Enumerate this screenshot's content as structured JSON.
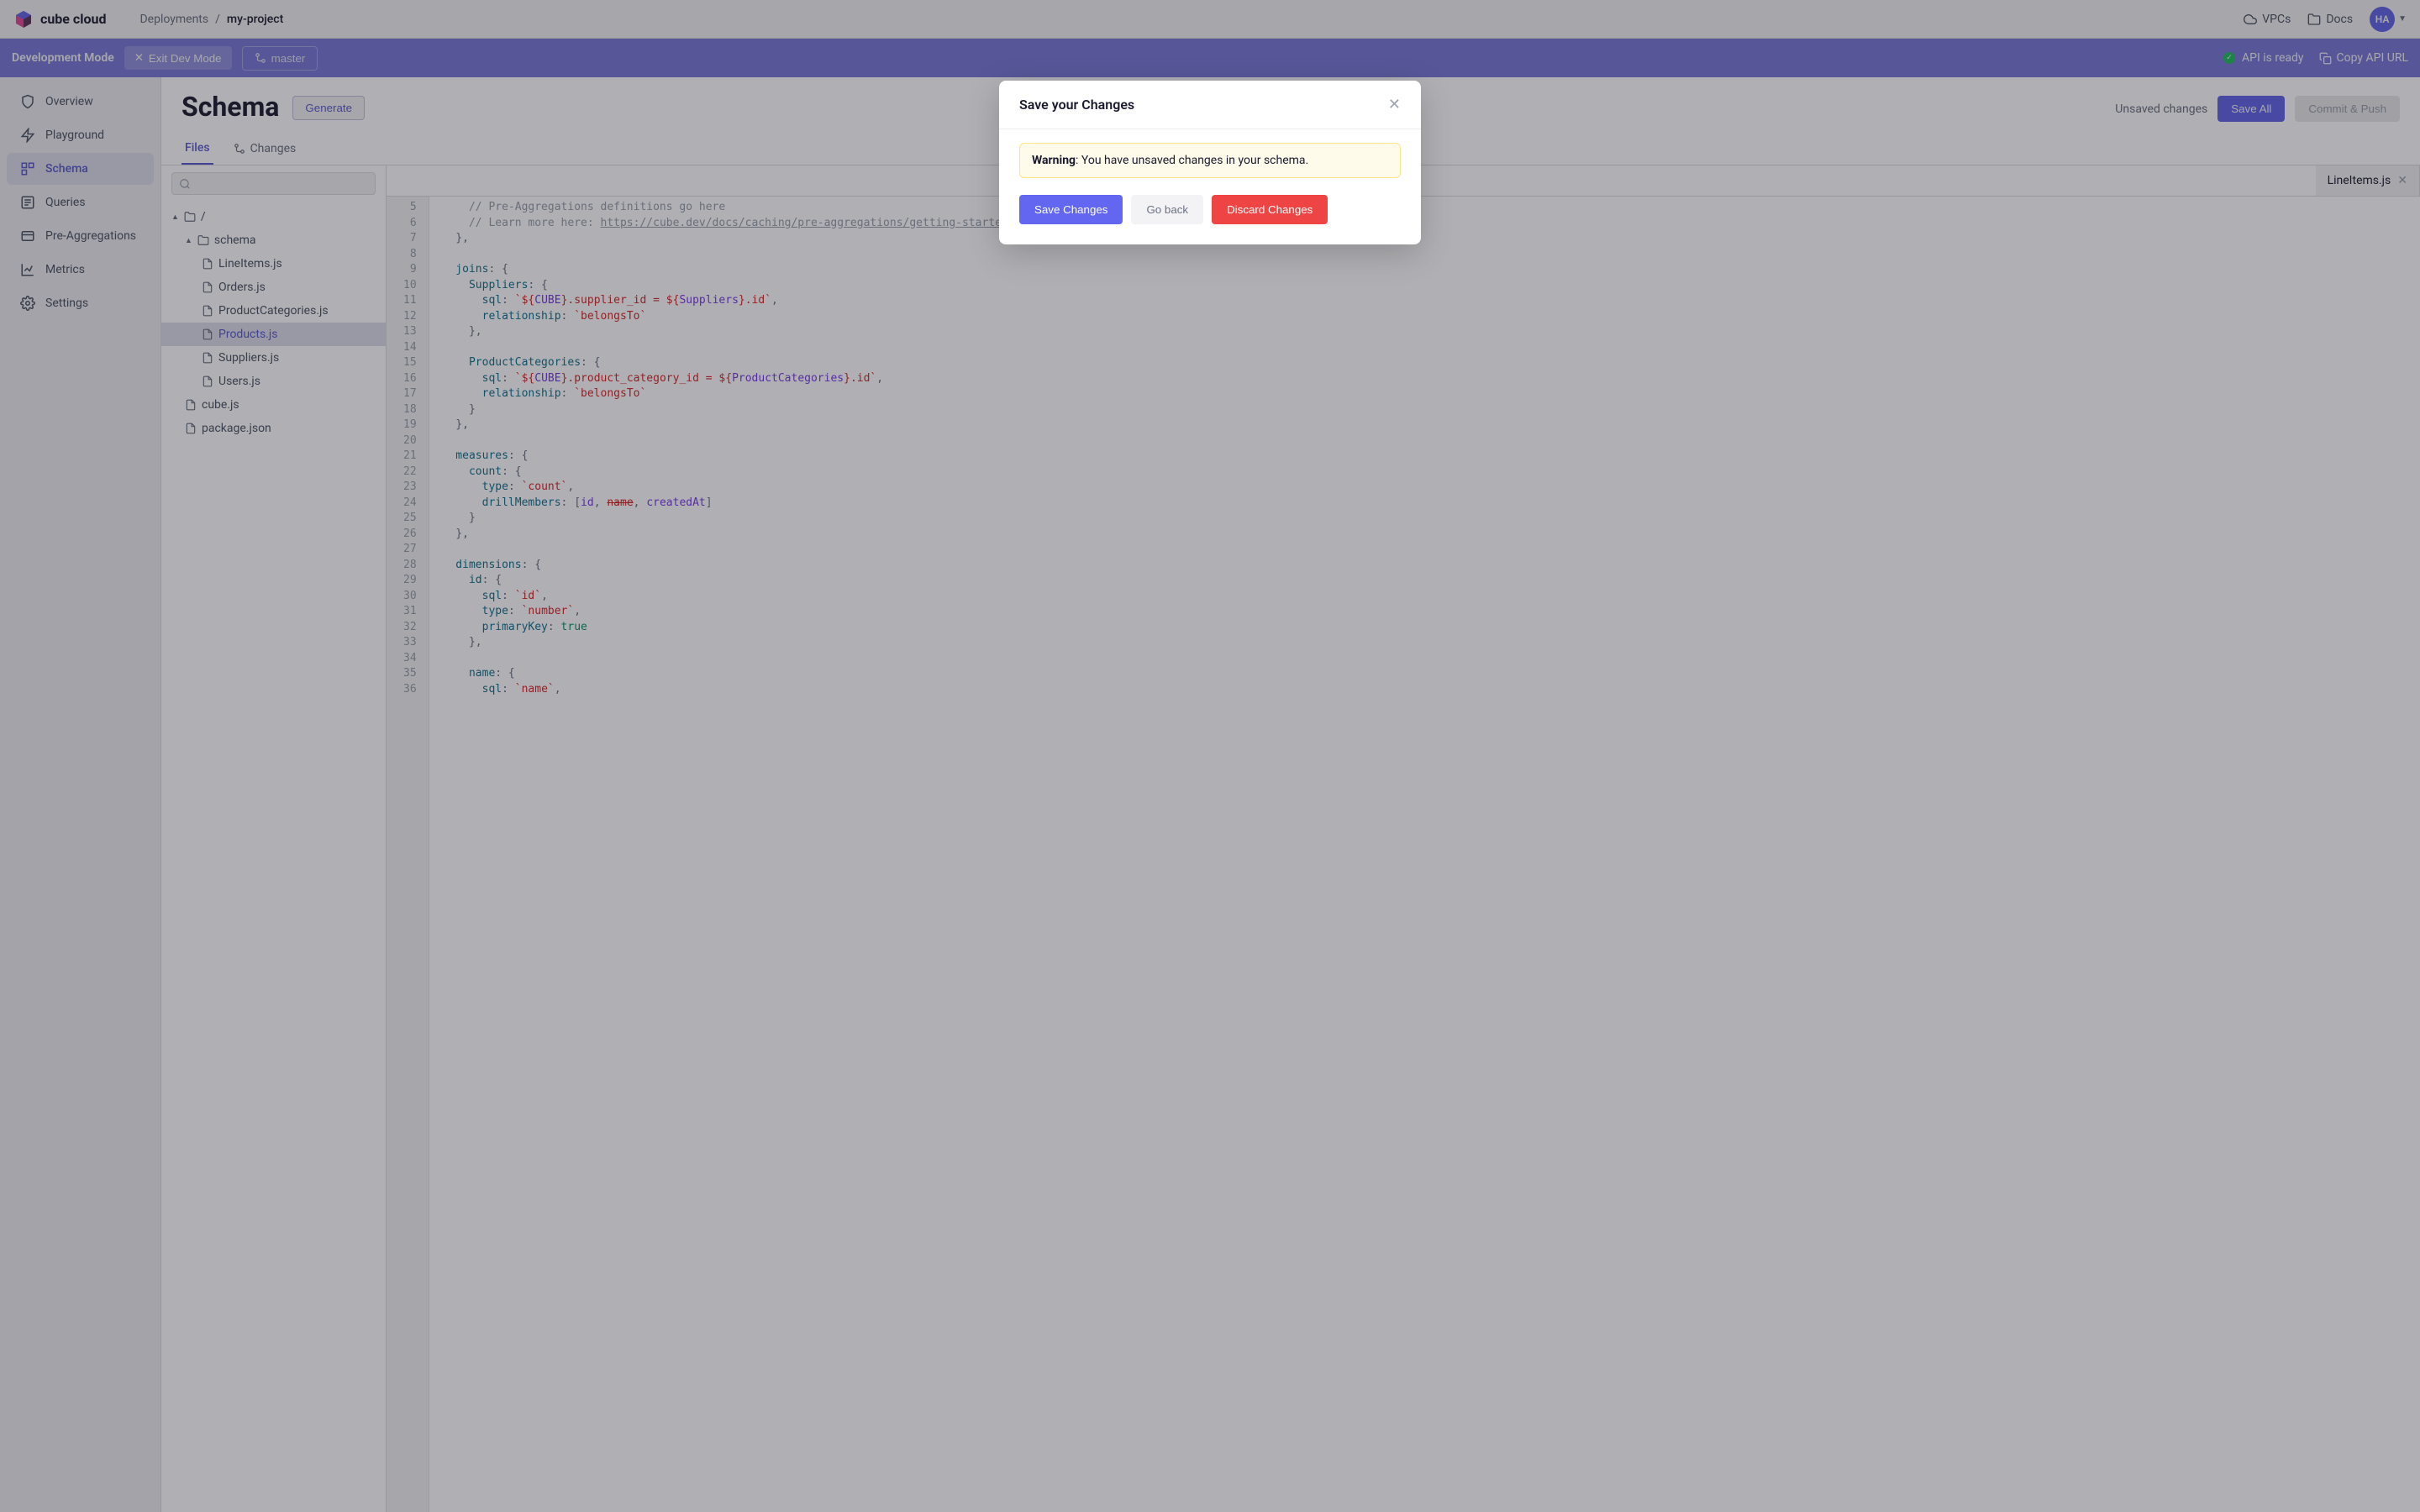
{
  "brand": "cube cloud",
  "breadcrumb": {
    "root": "Deployments",
    "sep": "/",
    "current": "my-project"
  },
  "top_links": {
    "vpcs": "VPCs",
    "docs": "Docs"
  },
  "avatar": "HA",
  "dev_bar": {
    "mode": "Development Mode",
    "exit": "Exit Dev Mode",
    "branch": "master",
    "api_ready": "API is ready",
    "copy_url": "Copy API URL"
  },
  "sidebar": [
    {
      "label": "Overview"
    },
    {
      "label": "Playground"
    },
    {
      "label": "Schema"
    },
    {
      "label": "Queries"
    },
    {
      "label": "Pre-Aggregations"
    },
    {
      "label": "Metrics"
    },
    {
      "label": "Settings"
    }
  ],
  "page_title": "Schema",
  "generate_label": "Generate",
  "unsaved": "Unsaved changes",
  "save_all": "Save All",
  "commit": "Commit & Push",
  "schema_tabs": {
    "files": "Files",
    "changes": "Changes"
  },
  "tree": {
    "root": "/",
    "schema_folder": "schema",
    "files": [
      "LineItems.js",
      "Orders.js",
      "ProductCategories.js",
      "Products.js",
      "Suppliers.js",
      "Users.js"
    ],
    "root_files": [
      "cube.js",
      "package.json"
    ]
  },
  "editor_tabs": [
    "LineItems.js"
  ],
  "active_editor_tab": "LineItems.js",
  "code_lines_start": 5,
  "code_lines_end": 36,
  "code_lines": [
    [
      [
        "cmt",
        "    // Pre-Aggregations definitions go here"
      ]
    ],
    [
      [
        "cmt",
        "    // Learn more here: "
      ],
      [
        "link",
        "https://cube.dev/docs/caching/pre-aggregations/getting-started"
      ]
    ],
    [
      [
        "punc",
        "  },"
      ]
    ],
    [
      [
        "",
        ""
      ]
    ],
    [
      [
        "key",
        "  joins"
      ],
      [
        "punc",
        ": {"
      ]
    ],
    [
      [
        "key",
        "    Suppliers"
      ],
      [
        "punc",
        ": {"
      ]
    ],
    [
      [
        "key",
        "      sql"
      ],
      [
        "punc",
        ": "
      ],
      [
        "str",
        "`${"
      ],
      [
        "var",
        "CUBE"
      ],
      [
        "str",
        "}.supplier_id = ${"
      ],
      [
        "var",
        "Suppliers"
      ],
      [
        "str",
        "}.id`"
      ],
      [
        "punc",
        ","
      ]
    ],
    [
      [
        "key",
        "      relationship"
      ],
      [
        "punc",
        ": "
      ],
      [
        "str",
        "`belongsTo`"
      ]
    ],
    [
      [
        "punc",
        "    },"
      ]
    ],
    [
      [
        "",
        ""
      ]
    ],
    [
      [
        "key",
        "    ProductCategories"
      ],
      [
        "punc",
        ": {"
      ]
    ],
    [
      [
        "key",
        "      sql"
      ],
      [
        "punc",
        ": "
      ],
      [
        "str",
        "`${"
      ],
      [
        "var",
        "CUBE"
      ],
      [
        "str",
        "}.product_category_id = ${"
      ],
      [
        "var",
        "ProductCategories"
      ],
      [
        "str",
        "}.id`"
      ],
      [
        "punc",
        ","
      ]
    ],
    [
      [
        "key",
        "      relationship"
      ],
      [
        "punc",
        ": "
      ],
      [
        "str",
        "`belongsTo`"
      ]
    ],
    [
      [
        "punc",
        "    }"
      ]
    ],
    [
      [
        "punc",
        "  },"
      ]
    ],
    [
      [
        "",
        ""
      ]
    ],
    [
      [
        "key",
        "  measures"
      ],
      [
        "punc",
        ": {"
      ]
    ],
    [
      [
        "key",
        "    count"
      ],
      [
        "punc",
        ": {"
      ]
    ],
    [
      [
        "key",
        "      type"
      ],
      [
        "punc",
        ": "
      ],
      [
        "str",
        "`count`"
      ],
      [
        "punc",
        ","
      ]
    ],
    [
      [
        "key",
        "      drillMembers"
      ],
      [
        "punc",
        ": ["
      ],
      [
        "var",
        "id"
      ],
      [
        "punc",
        ", "
      ],
      [
        "strike",
        "name"
      ],
      [
        "punc",
        ", "
      ],
      [
        "var",
        "createdAt"
      ],
      [
        "punc",
        "]"
      ]
    ],
    [
      [
        "punc",
        "    }"
      ]
    ],
    [
      [
        "punc",
        "  },"
      ]
    ],
    [
      [
        "",
        ""
      ]
    ],
    [
      [
        "key",
        "  dimensions"
      ],
      [
        "punc",
        ": {"
      ]
    ],
    [
      [
        "key",
        "    id"
      ],
      [
        "punc",
        ": {"
      ]
    ],
    [
      [
        "key",
        "      sql"
      ],
      [
        "punc",
        ": "
      ],
      [
        "str",
        "`id`"
      ],
      [
        "punc",
        ","
      ]
    ],
    [
      [
        "key",
        "      type"
      ],
      [
        "punc",
        ": "
      ],
      [
        "str",
        "`number`"
      ],
      [
        "punc",
        ","
      ]
    ],
    [
      [
        "key",
        "      primaryKey"
      ],
      [
        "punc",
        ": "
      ],
      [
        "bool",
        "true"
      ]
    ],
    [
      [
        "punc",
        "    },"
      ]
    ],
    [
      [
        "",
        ""
      ]
    ],
    [
      [
        "key",
        "    name"
      ],
      [
        "punc",
        ": {"
      ]
    ],
    [
      [
        "key",
        "      sql"
      ],
      [
        "punc",
        ": "
      ],
      [
        "str",
        "`name`"
      ],
      [
        "punc",
        ","
      ]
    ]
  ],
  "modal": {
    "title": "Save your Changes",
    "warning_prefix": "Warning",
    "warning_text": ": You have unsaved changes in your schema.",
    "save": "Save Changes",
    "back": "Go back",
    "discard": "Discard Changes"
  }
}
